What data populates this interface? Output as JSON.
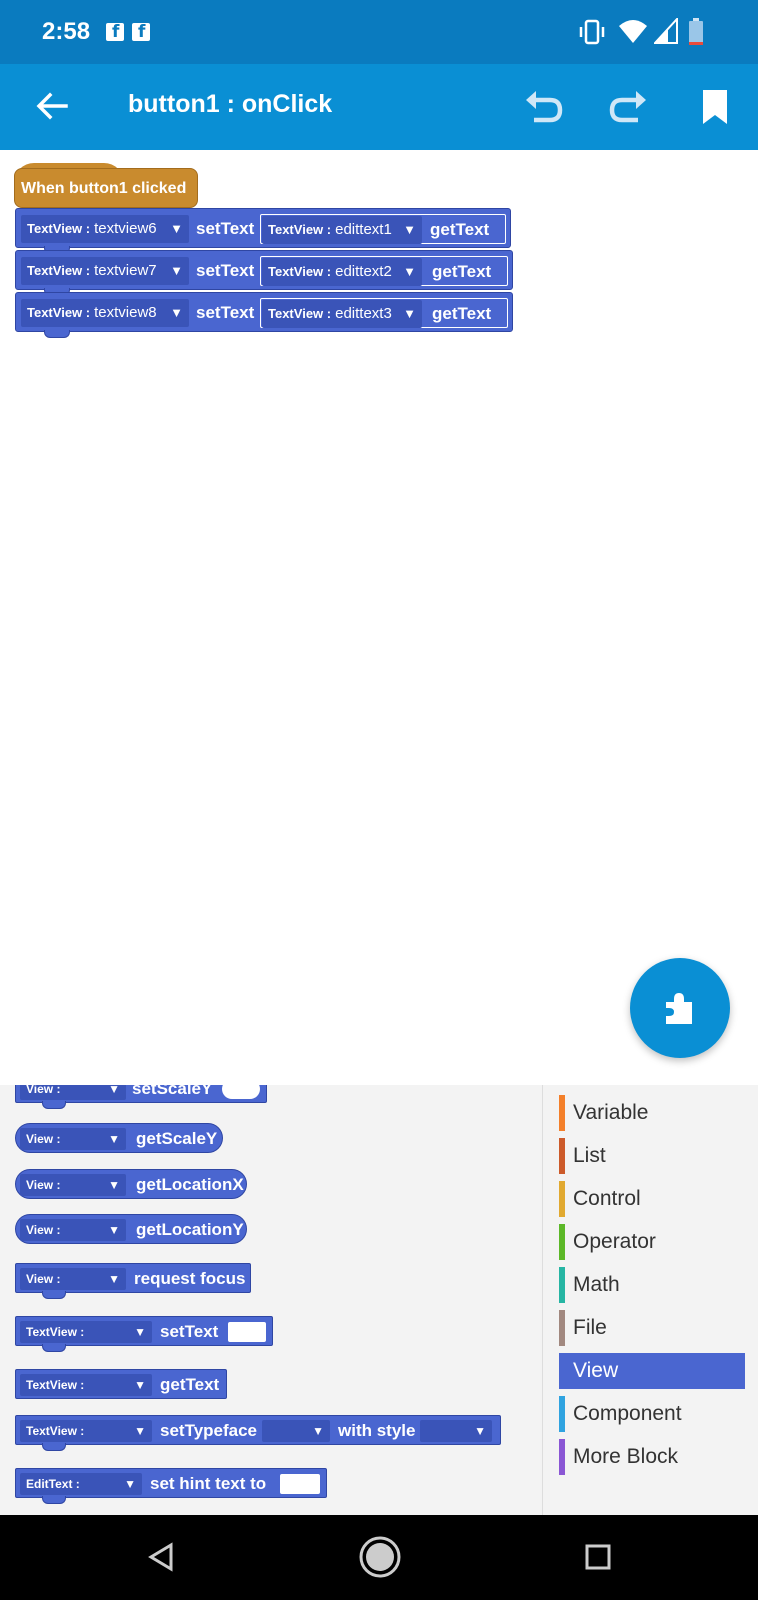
{
  "status_bar": {
    "time": "2:58",
    "notification_icons": [
      "facebook-icon",
      "facebook-icon"
    ],
    "system_icons": [
      "vibrate-icon",
      "wifi-icon",
      "signal-icon",
      "battery-icon"
    ]
  },
  "app_bar": {
    "title": "button1 : onClick",
    "icons": [
      "back-arrow-icon",
      "undo-icon",
      "redo-icon",
      "bookmark-icon"
    ]
  },
  "canvas": {
    "event_label": "When button1 clicked",
    "statements": [
      {
        "type_label": "TextView :",
        "target": "textview6",
        "action": "setText",
        "arg_type": "TextView :",
        "arg_target": "edittext1",
        "arg_action": "getText"
      },
      {
        "type_label": "TextView :",
        "target": "textview7",
        "action": "setText",
        "arg_type": "TextView :",
        "arg_target": "edittext2",
        "arg_action": "getText"
      },
      {
        "type_label": "TextView :",
        "target": "textview8",
        "action": "setText",
        "arg_type": "TextView :",
        "arg_target": "edittext3",
        "arg_action": "getText"
      }
    ],
    "dropdown_arrow": "▼"
  },
  "fab": {
    "icon": "puzzle-piece-icon"
  },
  "palette": {
    "blocks": [
      {
        "type_label": "View :",
        "action": "setScaleY"
      },
      {
        "type_label": "View :",
        "action": "getScaleY"
      },
      {
        "type_label": "View :",
        "action": "getLocationX"
      },
      {
        "type_label": "View :",
        "action": "getLocationY"
      },
      {
        "type_label": "View :",
        "action": "request focus"
      },
      {
        "type_label": "TextView :",
        "action": "setText"
      },
      {
        "type_label": "TextView :",
        "action": "getText"
      },
      {
        "type_label": "TextView :",
        "action": "setTypeface",
        "action2": "with style"
      },
      {
        "type_label": "EditText :",
        "action": "set hint text to"
      }
    ]
  },
  "categories": {
    "selected": "View",
    "items": [
      {
        "label": "Variable",
        "color": "#f37f2a"
      },
      {
        "label": "List",
        "color": "#cc5a2a"
      },
      {
        "label": "Control",
        "color": "#e1a930"
      },
      {
        "label": "Operator",
        "color": "#5cb828"
      },
      {
        "label": "Math",
        "color": "#26b5a3"
      },
      {
        "label": "File",
        "color": "#a1887f"
      },
      {
        "label": "View",
        "color": "#4a66d0"
      },
      {
        "label": "Component",
        "color": "#2fa3e0"
      },
      {
        "label": "More Block",
        "color": "#8a56d4"
      }
    ]
  },
  "nav_bar": {
    "icons": [
      "back-triangle-icon",
      "home-circle-icon",
      "recents-square-icon"
    ]
  }
}
